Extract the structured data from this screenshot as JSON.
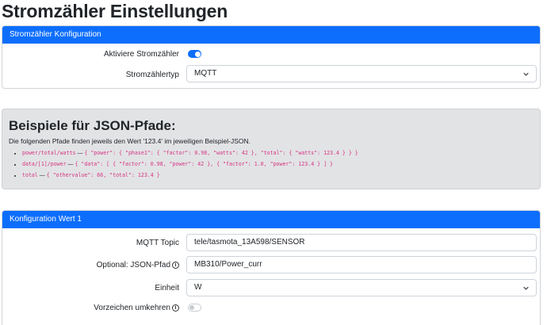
{
  "page_title": "Stromzähler Einstellungen",
  "config_card": {
    "header": "Stromzähler Konfiguration",
    "activate_label": "Aktiviere Stromzähler",
    "activate_on": true,
    "type_label": "Stromzählertyp",
    "type_value": "MQTT"
  },
  "examples": {
    "title": "Beispiele für JSON-Pfade:",
    "intro": "Die folgenden Pfade finden jeweils den Wert '123.4' im jeweiligen Beispiel-JSON.",
    "items": [
      {
        "path": "power/total/watts",
        "sep": " — ",
        "json": "{ \"power\": { \"phase1\": { \"factor\": 0.98, \"watts\": 42 }, \"total\": { \"watts\": 123.4 } } }"
      },
      {
        "path": "data/[1]/power",
        "sep": " — ",
        "json": "{ \"data\": [ { \"factor\": 0.98, \"power\": 42 }, { \"factor\": 1.0, \"power\": 123.4 } ] }"
      },
      {
        "path": "total",
        "sep": " — ",
        "json": "{ \"othervalue\": 66, \"total\": 123.4 }"
      }
    ]
  },
  "value_card": {
    "header": "Konfiguration Wert 1",
    "topic_label": "MQTT Topic",
    "topic_value": "tele/tasmota_13A598/SENSOR",
    "jsonpath_label": "Optional: JSON-Pfad",
    "jsonpath_value": "MB310/Power_curr",
    "unit_label": "Einheit",
    "unit_value": "W",
    "invert_label": "Vorzeichen umkehren",
    "invert_on": false
  },
  "icons": {
    "info": "info-icon",
    "select": "chevron-down-icon"
  },
  "colors": {
    "primary": "#0d6efd",
    "code": "#d63384",
    "example_bg": "#e2e3e5"
  }
}
